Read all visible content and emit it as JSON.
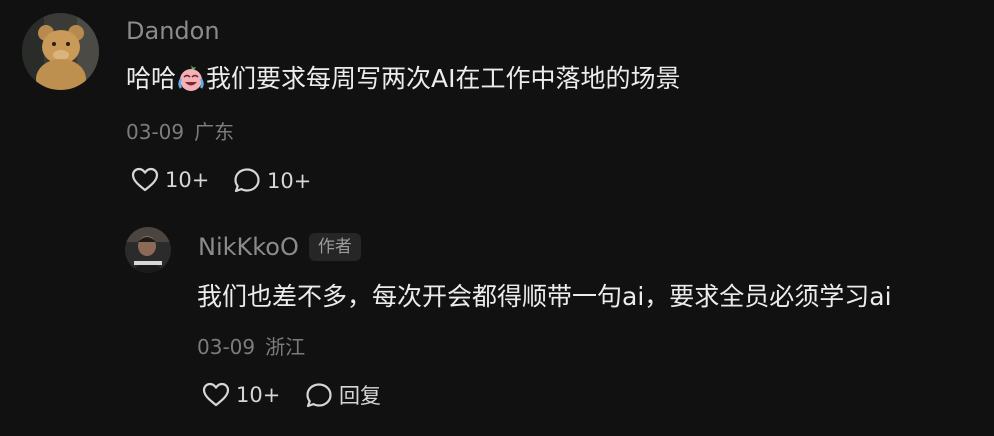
{
  "comment": {
    "username": "Dandon",
    "text_before": "哈哈",
    "emoji": "crying-laughing-emoji",
    "text_after": "我们要求每周写两次AI在工作中落地的场景",
    "date": "03-09",
    "location": "广东",
    "like_count": "10+",
    "reply_count": "10+"
  },
  "reply": {
    "username": "NikKkoO",
    "author_badge": "作者",
    "text": "我们也差不多，每次开会都得顺带一句ai，要求全员必须学习ai",
    "date": "03-09",
    "location": "浙江",
    "like_count": "10+",
    "reply_label": "回复"
  },
  "icons": {
    "like": "heart-outline-icon",
    "comment": "speech-bubble-icon"
  }
}
